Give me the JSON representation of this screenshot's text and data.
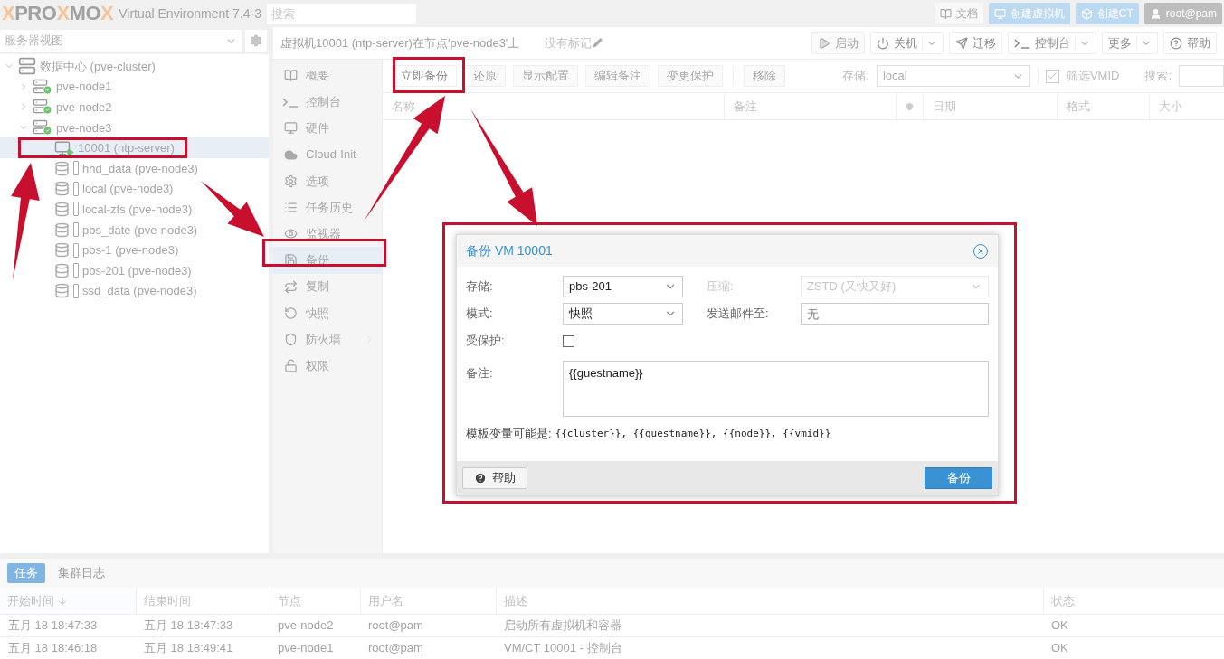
{
  "header": {
    "logo": [
      "X",
      "PRO",
      "X",
      "MO",
      "X"
    ],
    "product": "Virtual Environment 7.4-3",
    "search": {
      "placeholder": "搜索"
    },
    "buttons": [
      {
        "label": "文档",
        "kind": "plain"
      },
      {
        "label": "创建虚拟机",
        "kind": "primary"
      },
      {
        "label": "创建CT",
        "kind": "primary"
      },
      {
        "label": "root@pam",
        "kind": "user"
      }
    ]
  },
  "sidebar": {
    "view": "服务器视图",
    "tree": [
      {
        "label": "数据中心 (pve-cluster)",
        "kind": "datacenter",
        "expanded": true,
        "selected": false,
        "children": [
          {
            "label": "pve-node1",
            "kind": "node",
            "expanded": false,
            "selected": false
          },
          {
            "label": "pve-node2",
            "kind": "node",
            "expanded": false,
            "selected": false
          },
          {
            "label": "pve-node3",
            "kind": "node",
            "expanded": true,
            "selected": false,
            "children": [
              {
                "label": "10001 (ntp-server)",
                "kind": "vm",
                "selected": true
              },
              {
                "label": "hhd_data (pve-node3)",
                "kind": "storage",
                "selected": false
              },
              {
                "label": "local (pve-node3)",
                "kind": "storage",
                "selected": false
              },
              {
                "label": "local-zfs (pve-node3)",
                "kind": "storage",
                "selected": false
              },
              {
                "label": "pbs_date (pve-node3)",
                "kind": "storage",
                "selected": false
              },
              {
                "label": "pbs-1 (pve-node3)",
                "kind": "storage",
                "selected": false
              },
              {
                "label": "pbs-201 (pve-node3)",
                "kind": "storage",
                "selected": false
              },
              {
                "label": "ssd_data (pve-node3)",
                "kind": "storage",
                "selected": false
              }
            ]
          }
        ]
      }
    ]
  },
  "vm_header": {
    "title": "虚拟机10001 (ntp-server)在节点'pve-node3'上",
    "tags": "没有标记",
    "buttons": [
      {
        "label": "启动",
        "dropdown": false,
        "disabled": true
      },
      {
        "label": "关机",
        "dropdown": true,
        "disabled": false
      },
      {
        "label": "迁移",
        "dropdown": false,
        "disabled": false
      },
      {
        "label": "控制台",
        "dropdown": true,
        "disabled": false
      },
      {
        "label": "更多",
        "dropdown": true,
        "disabled": false
      },
      {
        "label": "帮助",
        "dropdown": false,
        "disabled": false
      }
    ]
  },
  "nav": [
    {
      "label": "概要",
      "selected": false,
      "submenu": false
    },
    {
      "label": "控制台",
      "selected": false,
      "submenu": false
    },
    {
      "label": "硬件",
      "selected": false,
      "submenu": false
    },
    {
      "label": "Cloud-Init",
      "selected": false,
      "submenu": false
    },
    {
      "label": "选项",
      "selected": false,
      "submenu": false
    },
    {
      "label": "任务历史",
      "selected": false,
      "submenu": false
    },
    {
      "label": "监视器",
      "selected": false,
      "submenu": false
    },
    {
      "label": "备份",
      "selected": true,
      "submenu": false
    },
    {
      "label": "复制",
      "selected": false,
      "submenu": false
    },
    {
      "label": "快照",
      "selected": false,
      "submenu": false
    },
    {
      "label": "防火墙",
      "selected": false,
      "submenu": true
    },
    {
      "label": "权限",
      "selected": false,
      "submenu": false
    }
  ],
  "toolbar": {
    "buttons": [
      {
        "label": "立即备份",
        "disabled": false
      },
      {
        "label": "还原",
        "disabled": true
      },
      {
        "label": "显示配置",
        "disabled": true
      },
      {
        "label": "编辑备注",
        "disabled": true
      },
      {
        "label": "变更保护",
        "disabled": true
      },
      {
        "label": "移除",
        "disabled": true
      }
    ],
    "storage_label": "存储:",
    "storage_value": "local",
    "filter": {
      "label": "筛选VMID",
      "checked": true
    },
    "search_label": "搜索:"
  },
  "table": {
    "columns": [
      "名称",
      "备注",
      "",
      "日期",
      "格式",
      "大小"
    ]
  },
  "dialog": {
    "title": "备份 VM 10001",
    "storage": {
      "label": "存储:",
      "value": "pbs-201"
    },
    "mode": {
      "label": "模式:",
      "value": "快照"
    },
    "protected": {
      "label": "受保护:",
      "checked": false
    },
    "compression": {
      "label": "压缩:",
      "value": "ZSTD (又快又好)",
      "disabled": true
    },
    "email": {
      "label": "发送邮件至:",
      "placeholder": "无"
    },
    "notes": {
      "label": "备注:",
      "value": "{{guestname}}"
    },
    "hint": {
      "label": "模板变量可能是:",
      "variables": "{{cluster}}, {{guestname}}, {{node}}, {{vmid}}"
    },
    "help": "帮助",
    "submit": "备份"
  },
  "tasks": {
    "tabs": [
      {
        "label": "任务",
        "selected": true
      },
      {
        "label": "集群日志",
        "selected": false
      }
    ],
    "columns": [
      "开始时间",
      "结束时间",
      "节点",
      "用户名",
      "描述",
      "状态"
    ],
    "rows": [
      [
        "五月 18 18:47:33",
        "五月 18 18:47:33",
        "pve-node2",
        "root@pam",
        "启动所有虚拟机和容器",
        "OK"
      ],
      [
        "五月 18 18:46:18",
        "五月 18 18:49:41",
        "pve-node1",
        "root@pam",
        "VM/CT 10001 - 控制台",
        "OK"
      ]
    ]
  }
}
